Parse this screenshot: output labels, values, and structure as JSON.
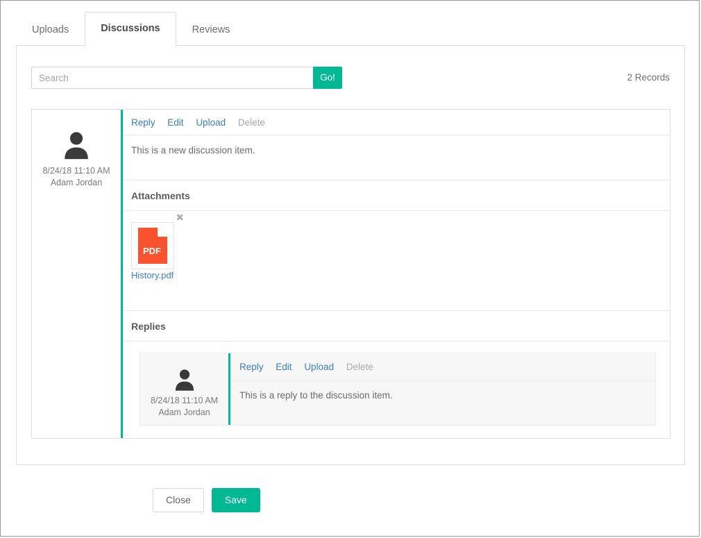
{
  "tabs": [
    {
      "label": "Uploads",
      "active": false
    },
    {
      "label": "Discussions",
      "active": true
    },
    {
      "label": "Reviews",
      "active": false
    }
  ],
  "search": {
    "value": "",
    "placeholder": "Search",
    "go_label": "Go!"
  },
  "records_label": "2 Records",
  "discussion": {
    "author": {
      "timestamp": "8/24/18 11:10 AM",
      "name": "Adam Jordan"
    },
    "actions": [
      {
        "label": "Reply",
        "disabled": false
      },
      {
        "label": "Edit",
        "disabled": false
      },
      {
        "label": "Upload",
        "disabled": false
      },
      {
        "label": "Delete",
        "disabled": true
      }
    ],
    "message": "This is a new discussion item.",
    "attachments_heading": "Attachments",
    "attachments": [
      {
        "filename": "History.pdf",
        "type": "PDF",
        "remove_glyph": "✖"
      }
    ],
    "replies_heading": "Replies",
    "replies": [
      {
        "author": {
          "timestamp": "8/24/18 11:10 AM",
          "name": "Adam Jordan"
        },
        "actions": [
          {
            "label": "Reply",
            "disabled": false
          },
          {
            "label": "Edit",
            "disabled": false
          },
          {
            "label": "Upload",
            "disabled": false
          },
          {
            "label": "Delete",
            "disabled": true
          }
        ],
        "message": "This is a reply to the discussion item."
      }
    ]
  },
  "footer": {
    "close_label": "Close",
    "save_label": "Save"
  },
  "colors": {
    "accent_green": "#00b894",
    "link_blue": "#3b7dc4",
    "pdf_orange": "#f9522e",
    "avatar_gray": "#3a3a3a",
    "disabled_gray": "#a8a8a8"
  }
}
